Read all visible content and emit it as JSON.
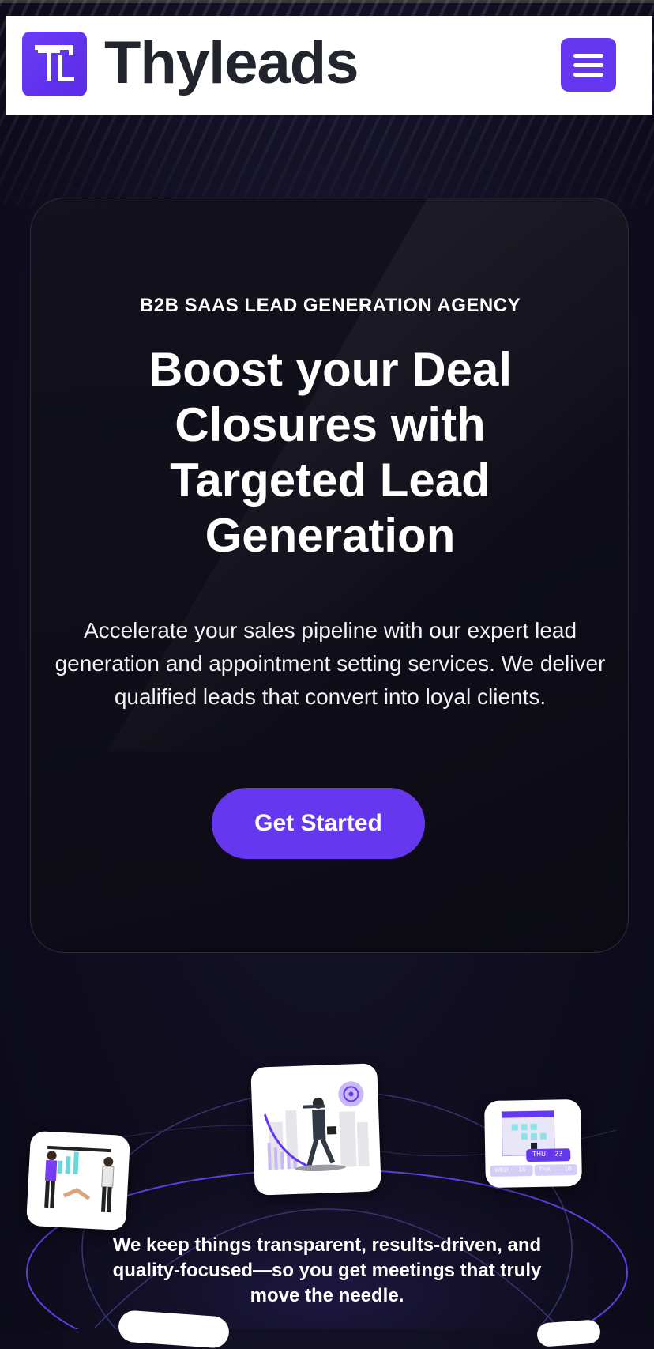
{
  "header": {
    "brand_name": "Thyleads",
    "logo_letters": "TL",
    "menu_icon": "hamburger-menu-icon",
    "accent": "#6537ef"
  },
  "hero": {
    "eyebrow": "B2B SAAS LEAD GENERATION AGENCY",
    "headline": "Boost your Deal Closures with Targeted Lead Generation",
    "subtext": "Accelerate your sales pipeline with our expert lead generation and appointment setting services. We deliver qualified leads that convert into loyal clients.",
    "cta_label": "Get Started"
  },
  "illustrations": {
    "left": "handshake-presentation-illustration",
    "center": "target-growth-illustration",
    "right": "calendar-scheduling-illustration",
    "calendar_labels": {
      "highlight": "THU",
      "highlight_day": "23",
      "days": [
        "WED",
        "15",
        "THA",
        "10"
      ]
    }
  },
  "tagline": "We keep things transparent, results-driven, and quality-focused—so you get meetings that truly move the needle.",
  "colors": {
    "background": "#100e20",
    "accent": "#6537ef",
    "card_border": "#2e2c3c"
  }
}
